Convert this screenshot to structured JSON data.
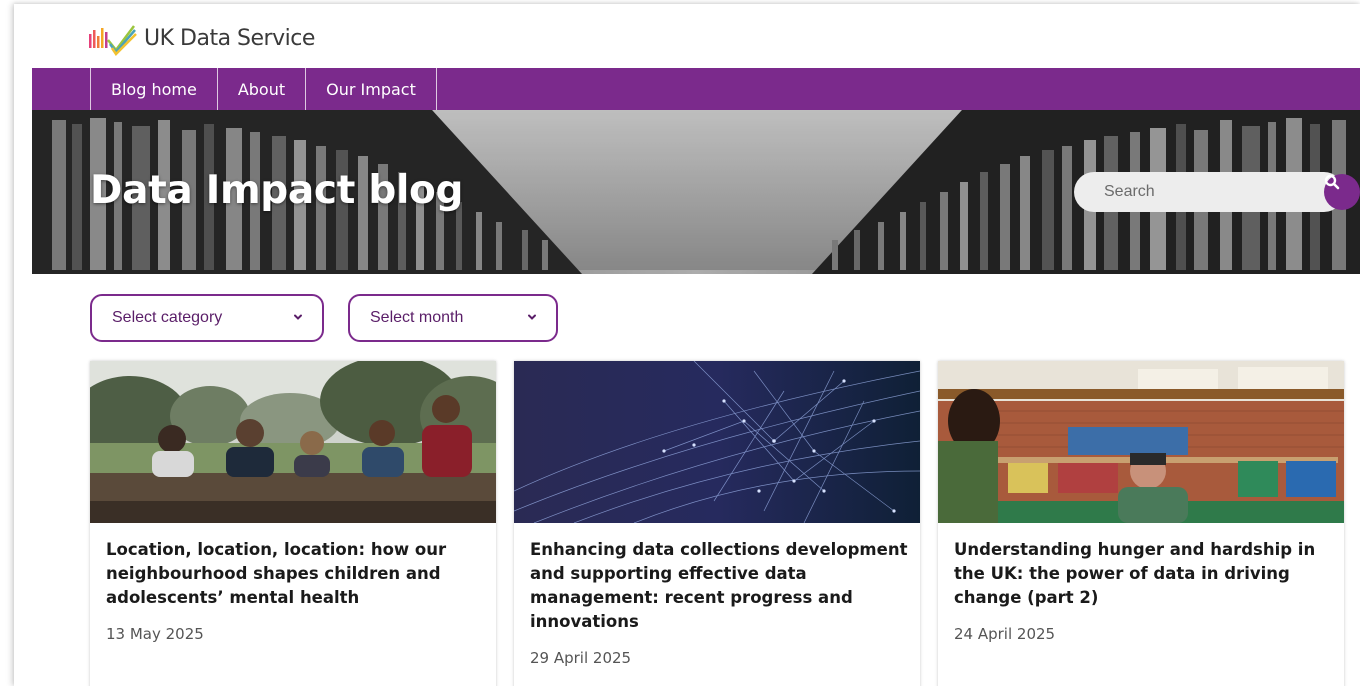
{
  "brand": {
    "name": "UK Data Service"
  },
  "nav": {
    "items": [
      {
        "label": "Blog home"
      },
      {
        "label": "About"
      },
      {
        "label": "Our Impact"
      }
    ]
  },
  "hero": {
    "title": "Data Impact blog"
  },
  "search": {
    "placeholder": "Search"
  },
  "filters": {
    "category_label": "Select category",
    "month_label": "Select month"
  },
  "posts": [
    {
      "title": "Location, location, location: how our neighbourhood shapes children and adolescents’ mental health",
      "date": "13 May 2025"
    },
    {
      "title": "Enhancing data collections development and supporting effective data management: recent progress and innovations",
      "date": "29 April 2025"
    },
    {
      "title": "Understanding hunger and hardship in the UK: the power of data in driving change (part 2)",
      "date": "24 April 2025"
    }
  ],
  "colors": {
    "brand_purple": "#7b2a8c",
    "text_dark": "#1a1a1a",
    "date_gray": "#555555"
  },
  "icons": {
    "search": "search-icon",
    "dropdown": "chevron-down-icon"
  }
}
